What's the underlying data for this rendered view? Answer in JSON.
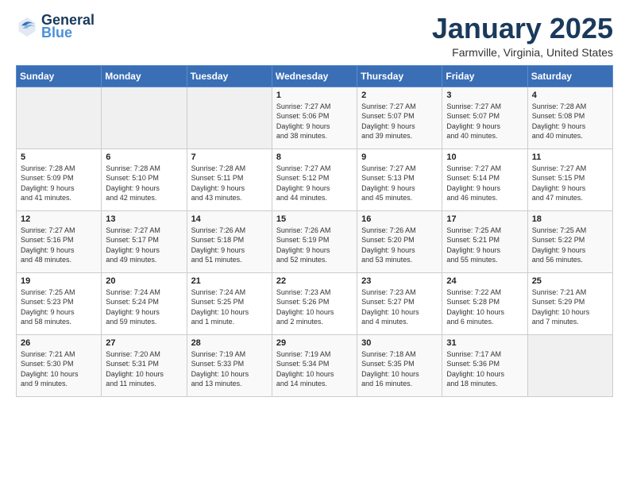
{
  "header": {
    "logo_line1": "General",
    "logo_line2": "Blue",
    "title": "January 2025",
    "location": "Farmville, Virginia, United States"
  },
  "weekdays": [
    "Sunday",
    "Monday",
    "Tuesday",
    "Wednesday",
    "Thursday",
    "Friday",
    "Saturday"
  ],
  "weeks": [
    [
      {
        "day": "",
        "info": ""
      },
      {
        "day": "",
        "info": ""
      },
      {
        "day": "",
        "info": ""
      },
      {
        "day": "1",
        "info": "Sunrise: 7:27 AM\nSunset: 5:06 PM\nDaylight: 9 hours\nand 38 minutes."
      },
      {
        "day": "2",
        "info": "Sunrise: 7:27 AM\nSunset: 5:07 PM\nDaylight: 9 hours\nand 39 minutes."
      },
      {
        "day": "3",
        "info": "Sunrise: 7:27 AM\nSunset: 5:07 PM\nDaylight: 9 hours\nand 40 minutes."
      },
      {
        "day": "4",
        "info": "Sunrise: 7:28 AM\nSunset: 5:08 PM\nDaylight: 9 hours\nand 40 minutes."
      }
    ],
    [
      {
        "day": "5",
        "info": "Sunrise: 7:28 AM\nSunset: 5:09 PM\nDaylight: 9 hours\nand 41 minutes."
      },
      {
        "day": "6",
        "info": "Sunrise: 7:28 AM\nSunset: 5:10 PM\nDaylight: 9 hours\nand 42 minutes."
      },
      {
        "day": "7",
        "info": "Sunrise: 7:28 AM\nSunset: 5:11 PM\nDaylight: 9 hours\nand 43 minutes."
      },
      {
        "day": "8",
        "info": "Sunrise: 7:27 AM\nSunset: 5:12 PM\nDaylight: 9 hours\nand 44 minutes."
      },
      {
        "day": "9",
        "info": "Sunrise: 7:27 AM\nSunset: 5:13 PM\nDaylight: 9 hours\nand 45 minutes."
      },
      {
        "day": "10",
        "info": "Sunrise: 7:27 AM\nSunset: 5:14 PM\nDaylight: 9 hours\nand 46 minutes."
      },
      {
        "day": "11",
        "info": "Sunrise: 7:27 AM\nSunset: 5:15 PM\nDaylight: 9 hours\nand 47 minutes."
      }
    ],
    [
      {
        "day": "12",
        "info": "Sunrise: 7:27 AM\nSunset: 5:16 PM\nDaylight: 9 hours\nand 48 minutes."
      },
      {
        "day": "13",
        "info": "Sunrise: 7:27 AM\nSunset: 5:17 PM\nDaylight: 9 hours\nand 49 minutes."
      },
      {
        "day": "14",
        "info": "Sunrise: 7:26 AM\nSunset: 5:18 PM\nDaylight: 9 hours\nand 51 minutes."
      },
      {
        "day": "15",
        "info": "Sunrise: 7:26 AM\nSunset: 5:19 PM\nDaylight: 9 hours\nand 52 minutes."
      },
      {
        "day": "16",
        "info": "Sunrise: 7:26 AM\nSunset: 5:20 PM\nDaylight: 9 hours\nand 53 minutes."
      },
      {
        "day": "17",
        "info": "Sunrise: 7:25 AM\nSunset: 5:21 PM\nDaylight: 9 hours\nand 55 minutes."
      },
      {
        "day": "18",
        "info": "Sunrise: 7:25 AM\nSunset: 5:22 PM\nDaylight: 9 hours\nand 56 minutes."
      }
    ],
    [
      {
        "day": "19",
        "info": "Sunrise: 7:25 AM\nSunset: 5:23 PM\nDaylight: 9 hours\nand 58 minutes."
      },
      {
        "day": "20",
        "info": "Sunrise: 7:24 AM\nSunset: 5:24 PM\nDaylight: 9 hours\nand 59 minutes."
      },
      {
        "day": "21",
        "info": "Sunrise: 7:24 AM\nSunset: 5:25 PM\nDaylight: 10 hours\nand 1 minute."
      },
      {
        "day": "22",
        "info": "Sunrise: 7:23 AM\nSunset: 5:26 PM\nDaylight: 10 hours\nand 2 minutes."
      },
      {
        "day": "23",
        "info": "Sunrise: 7:23 AM\nSunset: 5:27 PM\nDaylight: 10 hours\nand 4 minutes."
      },
      {
        "day": "24",
        "info": "Sunrise: 7:22 AM\nSunset: 5:28 PM\nDaylight: 10 hours\nand 6 minutes."
      },
      {
        "day": "25",
        "info": "Sunrise: 7:21 AM\nSunset: 5:29 PM\nDaylight: 10 hours\nand 7 minutes."
      }
    ],
    [
      {
        "day": "26",
        "info": "Sunrise: 7:21 AM\nSunset: 5:30 PM\nDaylight: 10 hours\nand 9 minutes."
      },
      {
        "day": "27",
        "info": "Sunrise: 7:20 AM\nSunset: 5:31 PM\nDaylight: 10 hours\nand 11 minutes."
      },
      {
        "day": "28",
        "info": "Sunrise: 7:19 AM\nSunset: 5:33 PM\nDaylight: 10 hours\nand 13 minutes."
      },
      {
        "day": "29",
        "info": "Sunrise: 7:19 AM\nSunset: 5:34 PM\nDaylight: 10 hours\nand 14 minutes."
      },
      {
        "day": "30",
        "info": "Sunrise: 7:18 AM\nSunset: 5:35 PM\nDaylight: 10 hours\nand 16 minutes."
      },
      {
        "day": "31",
        "info": "Sunrise: 7:17 AM\nSunset: 5:36 PM\nDaylight: 10 hours\nand 18 minutes."
      },
      {
        "day": "",
        "info": ""
      }
    ]
  ]
}
